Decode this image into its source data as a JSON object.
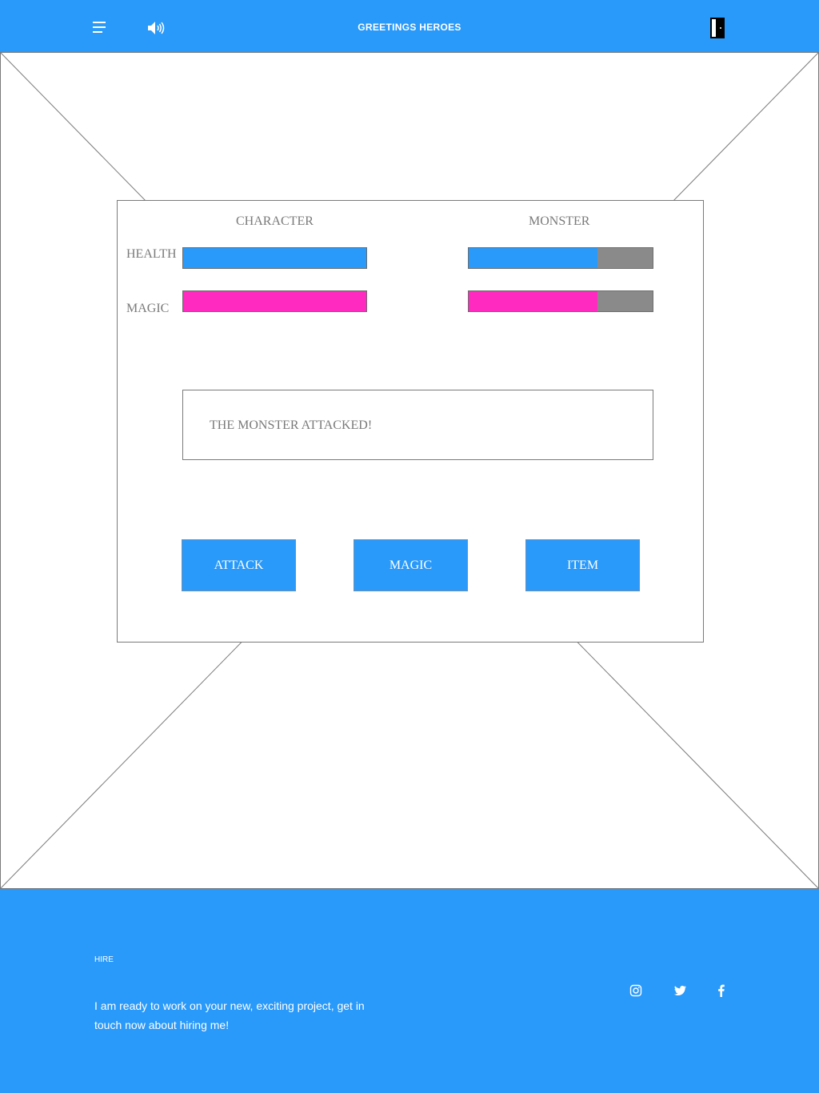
{
  "header": {
    "title": "GREETINGS HEROES",
    "menu_icon": "hamburger-menu-icon",
    "sound_icon": "speaker-icon",
    "exit_icon": "door-exit-icon"
  },
  "colors": {
    "primary": "#2999fa",
    "magic": "#ff2ac0",
    "empty_bar": "#8a8a8a",
    "text_gray": "#7a7a7a"
  },
  "battle": {
    "character_heading": "CHARACTER",
    "monster_heading": "MONSTER",
    "health_label": "HEALTH",
    "magic_label": "MAGIC",
    "character": {
      "health": 1.0,
      "magic": 1.0
    },
    "monster": {
      "health": 0.7,
      "magic": 0.7
    },
    "message": "THE MONSTER ATTACKED!",
    "actions": [
      "ATTACK",
      "MAGIC",
      "ITEM"
    ]
  },
  "footer": {
    "hire_label": "HIRE",
    "hire_text": "I am ready to work on your new, exciting project, get in touch now about hiring me!",
    "social": [
      "instagram-icon",
      "twitter-icon",
      "facebook-icon"
    ]
  }
}
